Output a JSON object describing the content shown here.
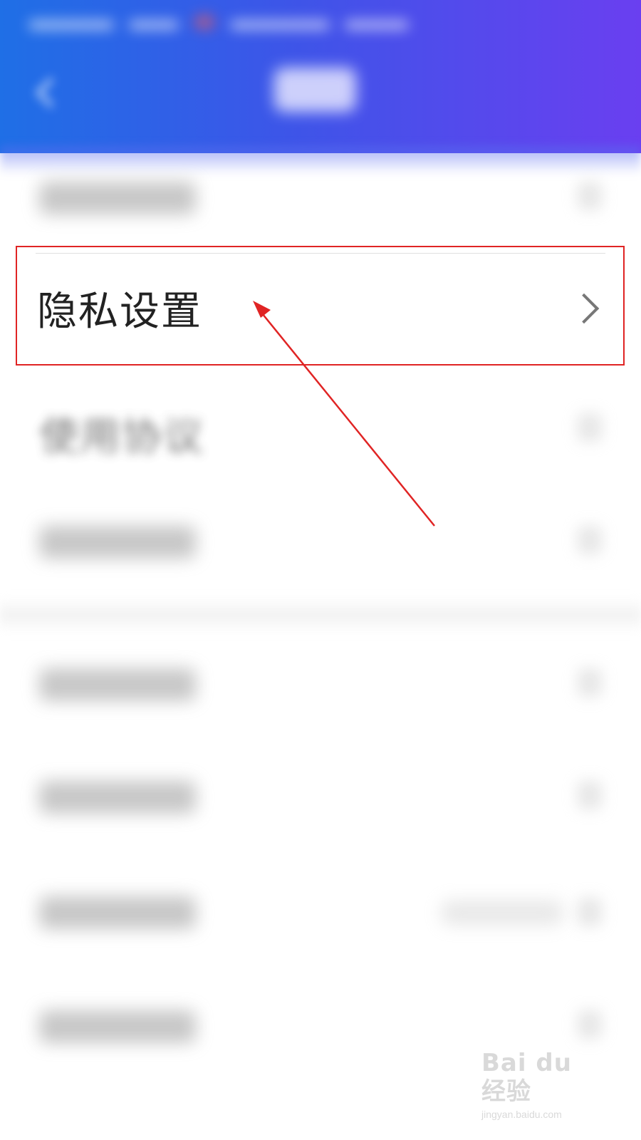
{
  "header": {
    "title_blurred": true,
    "back_icon": "back-arrow-icon",
    "colors": {
      "gradient_start": "#1f6fe6",
      "gradient_end": "#6a3ff0"
    }
  },
  "settings_list": {
    "highlighted_item": {
      "label": "隐私设置",
      "chevron_icon": "chevron-right-icon"
    },
    "partially_visible_item": {
      "label": "使用协议"
    }
  },
  "annotation": {
    "box_color": "#e02424",
    "arrow_color": "#e02424"
  },
  "watermark": {
    "logo": "Bai du 经验",
    "url": "jingyan.baidu.com"
  }
}
